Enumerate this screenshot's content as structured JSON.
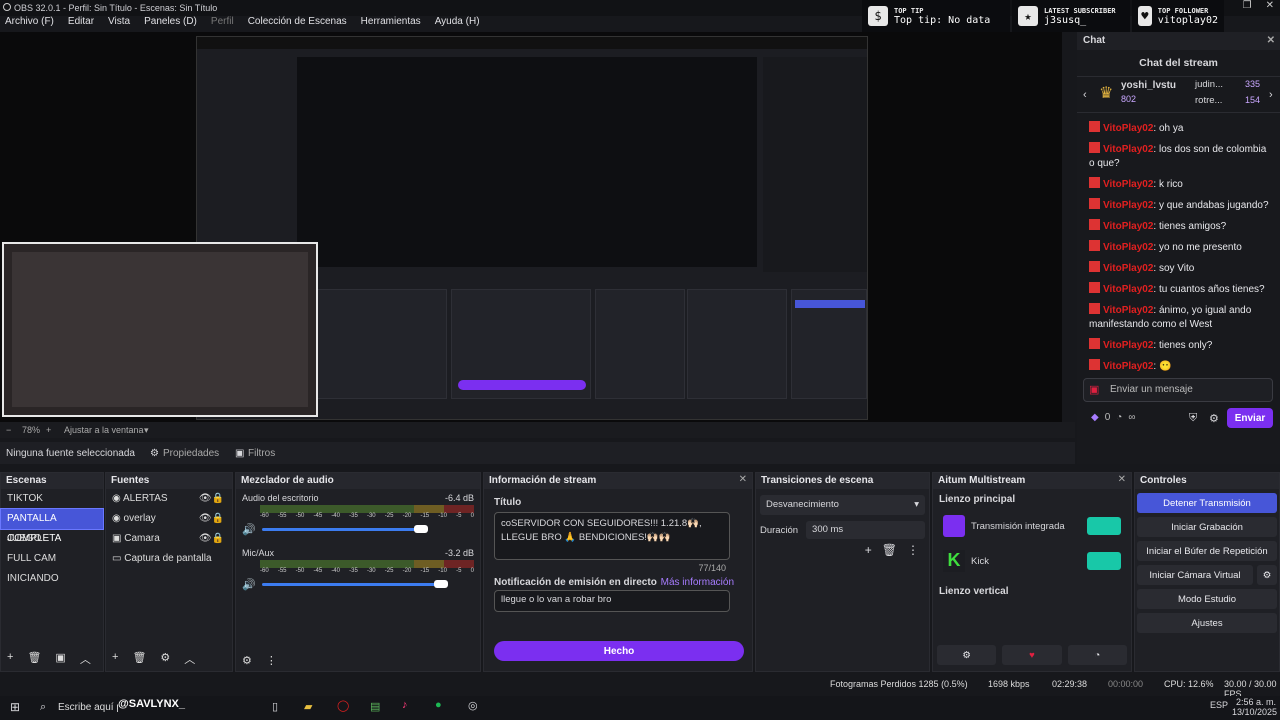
{
  "window": {
    "title": "OBS 32.0.1 - Perfil: Sin Título - Escenas: Sin Título"
  },
  "menu": [
    "Archivo (F)",
    "Editar",
    "Vista",
    "Paneles (D)",
    "Perfil",
    "Colección de Escenas",
    "Herramientas",
    "Ayuda (H)"
  ],
  "alerts": [
    {
      "label": "TOP TIP",
      "value": "Top tip: No data",
      "icon": "tip-icon"
    },
    {
      "label": "LATEST SUBSCRIBER",
      "value": "j3susq_",
      "icon": "star-icon"
    },
    {
      "label": "TOP FOLLOWER",
      "value": "vitoplay02",
      "icon": "heart-icon"
    }
  ],
  "preview": {
    "zoom": "78%",
    "fit": "Ajustar a la ventana"
  },
  "source_bar": {
    "label": "Ninguna fuente seleccionada",
    "props": "Propiedades",
    "filters": "Filtros"
  },
  "scenes": {
    "title": "Escenas",
    "items": [
      "TIKTOK",
      "PANTALLA COMPLETA",
      "JUEGO",
      "FULL CAM",
      "INICIANDO"
    ],
    "selected": 1
  },
  "sources": {
    "title": "Fuentes",
    "items": [
      "ALERTAS",
      "overlay",
      "Camara",
      "Captura de pantalla"
    ]
  },
  "mixer": {
    "title": "Mezclador de audio",
    "ticks": [
      "-60",
      "-55",
      "-50",
      "-45",
      "-40",
      "-35",
      "-30",
      "-25",
      "-20",
      "-15",
      "-10",
      "-5",
      "0"
    ],
    "channels": [
      {
        "name": "Audio del escritorio",
        "db": "-6.4 dB"
      },
      {
        "name": "Mic/Aux",
        "db": "-3.2 dB"
      }
    ]
  },
  "stream_info": {
    "title": "Información de stream",
    "title_label": "Título",
    "title_value": "coSERVIDOR CON SEGUIDORES!!! 1.21.8🙌🏻, LLEGUE BRO 🙏 BENDICIONES!🙌🏻🙌🏻",
    "count": "77/140",
    "notif_label": "Notificación de emisión en directo",
    "more": "Más información",
    "notif_value": "llegue o lo van a robar bro",
    "done": "Hecho"
  },
  "transitions": {
    "title": "Transiciones de escena",
    "selected": "Desvanecimiento",
    "duration_label": "Duración",
    "duration": "300 ms"
  },
  "multistream": {
    "title": "Aitum Multistream",
    "main": "Lienzo principal",
    "targets": [
      "Transmisión integrada",
      "Kick"
    ],
    "vertical": "Lienzo vertical"
  },
  "controls": {
    "title": "Controles",
    "buttons": [
      "Detener Transmisión",
      "Iniciar Grabación",
      "Iniciar el Búfer de Repetición",
      "Iniciar Cámara Virtual",
      "Modo Estudio",
      "Ajustes"
    ]
  },
  "chat": {
    "dock": "Chat",
    "header": "Chat del stream",
    "top_user": "yoshi_lvstu",
    "top_score": "802",
    "others": [
      {
        "name": "judin...",
        "score": "335"
      },
      {
        "name": "rotre...",
        "score": "154"
      }
    ],
    "messages": [
      {
        "user": "VitoPlay02",
        "text": "oh ya"
      },
      {
        "user": "VitoPlay02",
        "text": "los dos son de colombia o que?"
      },
      {
        "user": "VitoPlay02",
        "text": "k rico"
      },
      {
        "user": "VitoPlay02",
        "text": "y que andabas jugando?"
      },
      {
        "user": "VitoPlay02",
        "text": "tienes amigos?"
      },
      {
        "user": "VitoPlay02",
        "text": "yo no me presento"
      },
      {
        "user": "VitoPlay02",
        "text": "soy Vito"
      },
      {
        "user": "VitoPlay02",
        "text": "tu cuantos años tienes?"
      },
      {
        "user": "VitoPlay02",
        "text": "ánimo, yo igual ando manifestando como el West"
      },
      {
        "user": "VitoPlay02",
        "text": "tienes only?"
      },
      {
        "user": "VitoPlay02",
        "text": "😶"
      }
    ],
    "placeholder": "Enviar un mensaje",
    "points": "0",
    "infinity": "∞",
    "send": "Enviar"
  },
  "status": {
    "dropped": "Fotogramas Perdidos 1285 (0.5%)",
    "kbps": "1698 kbps",
    "live": "02:29:38",
    "rec": "00:00:00",
    "cpu": "CPU: 12.6%",
    "fps": "30.00 / 30.00 FPS"
  },
  "taskbar": {
    "search": "Escribe aquí para buscar",
    "overlay_tag": "@SAVLYNX_",
    "lang": "ESP",
    "time": "2:56 a. m.",
    "date": "13/10/2025"
  }
}
